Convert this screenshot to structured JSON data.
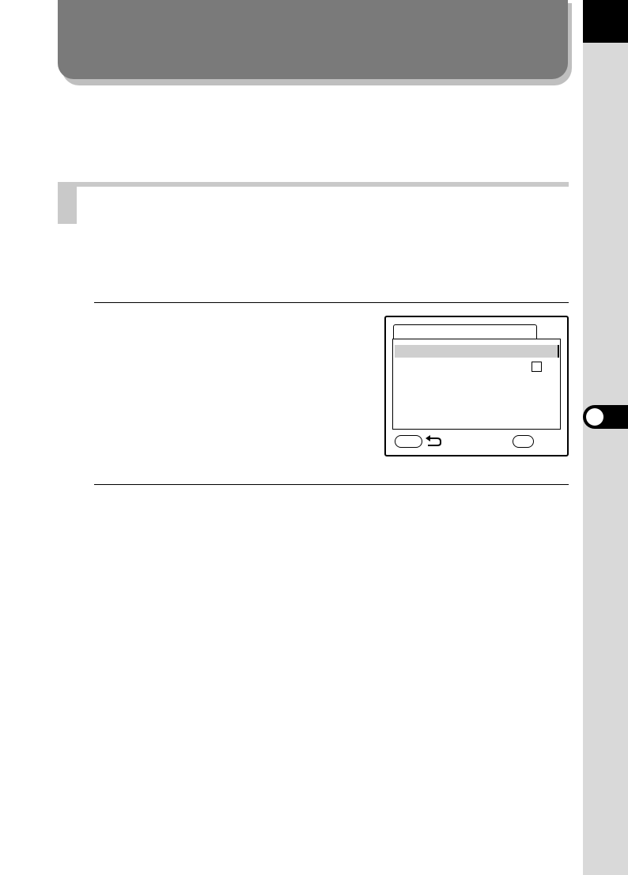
{
  "chapter": {
    "number": "",
    "title": ""
  },
  "section": {
    "title": ""
  },
  "lcd_menu": {
    "tab_label": "",
    "selected_item": "",
    "checkbox_checked": false,
    "icons": [
      "menu-button-icon",
      "back-arrow-icon",
      "ok-button-icon"
    ]
  },
  "colors": {
    "banner": "#7a7a7a",
    "side_strip": "#d9d9d9",
    "section_bar": "#c9c9c9",
    "selection": "#cfcfcf"
  }
}
